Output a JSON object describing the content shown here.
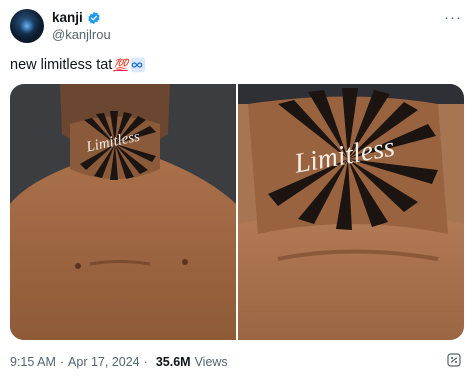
{
  "author": {
    "name": "kanji",
    "handle": "@kanjlrou"
  },
  "tweet": {
    "text": "new limitless tat",
    "emoji_100": "💯",
    "emoji_infinity": "infinity-icon"
  },
  "media": {
    "tattoo_text_left": "Limitless",
    "tattoo_text_right": "Limitless"
  },
  "meta": {
    "time": "9:15 AM",
    "separator": "·",
    "date": "Apr 17, 2024",
    "views_count": "35.6M",
    "views_label": "Views"
  },
  "icons": {
    "verified": "verified-badge-icon",
    "more": "more-icon",
    "grok": "grok-icon"
  },
  "colors": {
    "verified": "#1d9bf0",
    "text_primary": "#0f1419",
    "text_secondary": "#536471",
    "hundred": "#e0245e"
  }
}
